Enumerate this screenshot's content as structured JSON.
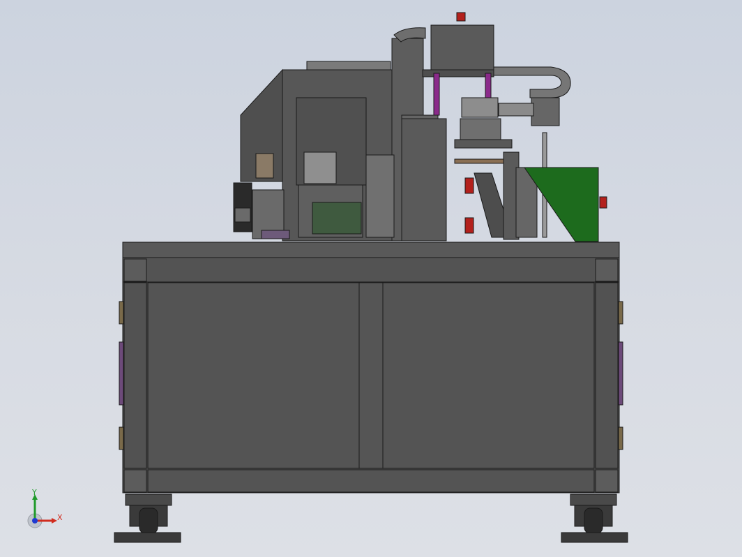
{
  "viewport": {
    "background_top": "#ccd3df",
    "background_bottom": "#dde0e6",
    "model": "machine-assembly-front-view"
  },
  "colors": {
    "body_fill": "#535353",
    "edge": "#1a1a1a",
    "panel_fill": "#5a5a5a",
    "light_part": "#9a9a9a",
    "green_guard": "#1d6b1d",
    "red_part": "#b3201c",
    "purple_part": "#8a2a8a"
  },
  "triad": {
    "x_label": "X",
    "y_label": "Y",
    "x_color": "#d12c1f",
    "y_color": "#1f9a2a",
    "z_color": "#1f3ad1"
  }
}
